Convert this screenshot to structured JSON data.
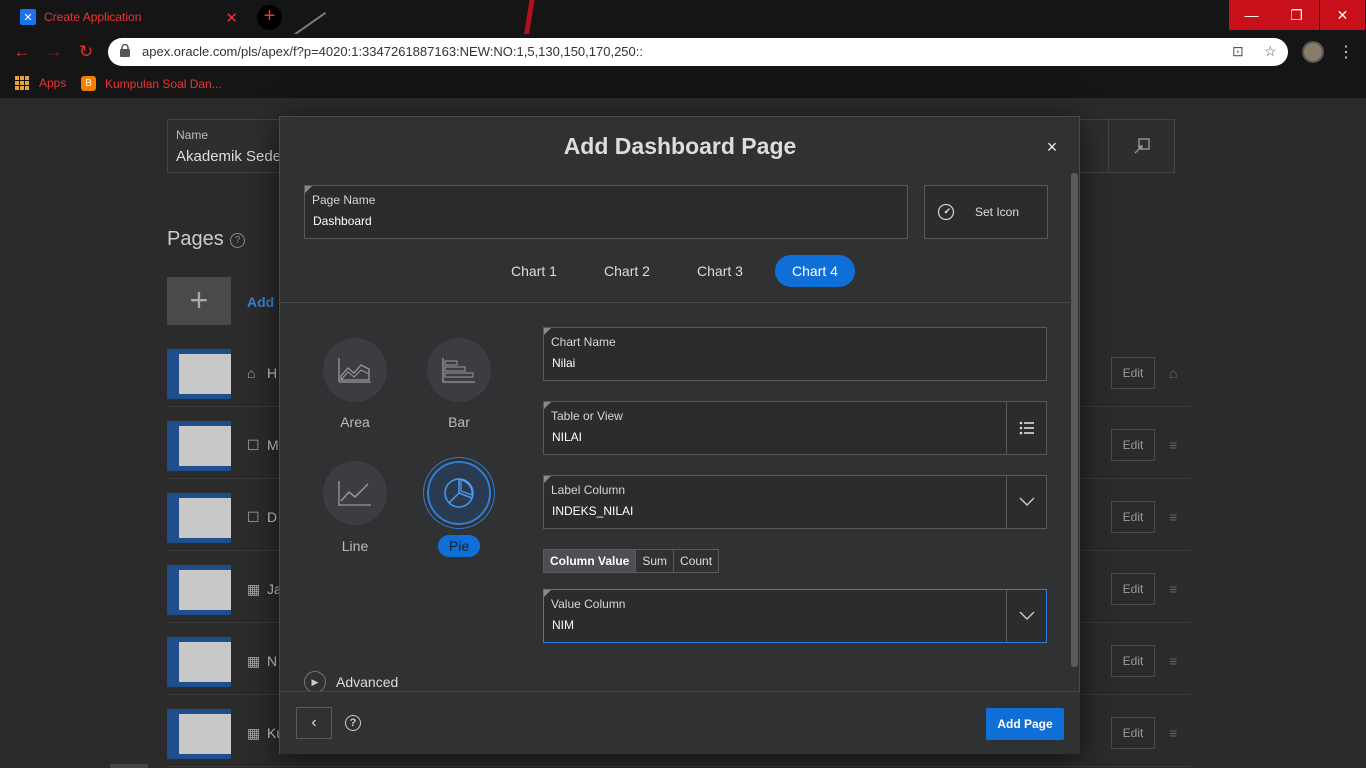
{
  "browser": {
    "tab_title": "Create Application",
    "tab_close": "✕",
    "new_tab": "+",
    "url": "apex.oracle.com/pls/apex/f?p=4020:1:3347261887163:NEW:NO:1,5,130,150,170,250::",
    "window_buttons": {
      "minimize": "—",
      "maximize": "❐",
      "close": "✕"
    },
    "bookmarks": [
      {
        "label": "Apps"
      },
      {
        "label": "Kumpulan Soal Dan..."
      }
    ]
  },
  "background_page": {
    "name_label": "Name",
    "name_value": "Akademik Sede",
    "pages_title": "Pages",
    "help": "?",
    "add_tile": "+",
    "add_link": "Add",
    "rows": [
      {
        "icon": "⌂",
        "name": "H",
        "edit": "Edit",
        "handle": "⌂"
      },
      {
        "icon": "☐",
        "name": "M",
        "edit": "Edit",
        "handle": "≡"
      },
      {
        "icon": "☐",
        "name": "D",
        "edit": "Edit",
        "handle": "≡"
      },
      {
        "icon": "▦",
        "name": "Ja",
        "edit": "Edit",
        "handle": "≡"
      },
      {
        "icon": "▦",
        "name": "N",
        "edit": "Edit",
        "handle": "≡"
      },
      {
        "icon": "▦",
        "name": "Ku",
        "edit": "Edit",
        "handle": "≡"
      }
    ]
  },
  "modal": {
    "title": "Add Dashboard Page",
    "close": "×",
    "page_name": {
      "label": "Page Name",
      "value": "Dashboard"
    },
    "set_icon": "Set Icon",
    "tabs": [
      {
        "label": "Chart 1",
        "active": false
      },
      {
        "label": "Chart 2",
        "active": false
      },
      {
        "label": "Chart 3",
        "active": false
      },
      {
        "label": "Chart 4",
        "active": true
      }
    ],
    "chart_types": [
      {
        "label": "Area",
        "icon": "area-chart-icon",
        "active": false
      },
      {
        "label": "Bar",
        "icon": "bar-chart-icon",
        "active": false
      },
      {
        "label": "Line",
        "icon": "line-chart-icon",
        "active": false
      },
      {
        "label": "Pie",
        "icon": "pie-chart-icon",
        "active": true
      }
    ],
    "chart_name": {
      "label": "Chart Name",
      "value": "Nilai"
    },
    "table_or_view": {
      "label": "Table or View",
      "value": "NILAI"
    },
    "label_column": {
      "label": "Label Column",
      "value": "INDEKS_NILAI"
    },
    "aggregation": {
      "options": [
        "Column Value",
        "Sum",
        "Count"
      ],
      "selected": "Column Value"
    },
    "value_column": {
      "label": "Value Column",
      "value": "NIM"
    },
    "advanced": "Advanced",
    "footer": {
      "back": "‹",
      "help": "?",
      "add_page": "Add Page"
    }
  },
  "colors": {
    "accent": "#0f6fd6",
    "browser_red": "#c8101a",
    "modal_bg": "#303133"
  }
}
